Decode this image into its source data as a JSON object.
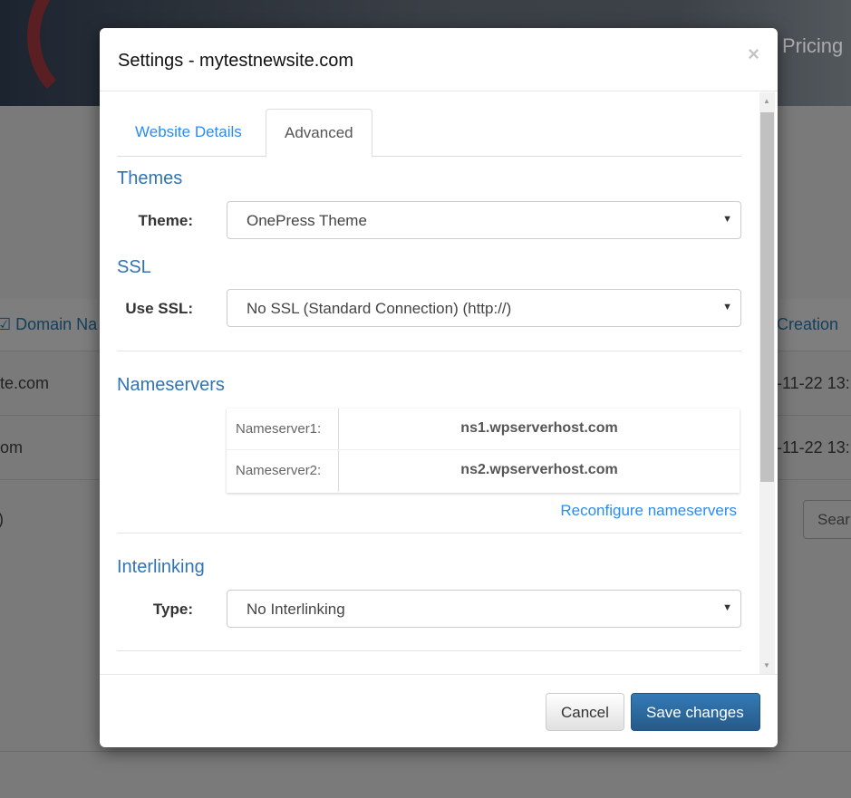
{
  "background": {
    "nav_item": "Pricing",
    "table_header": [
      "☑ Domain Na",
      "Creation"
    ],
    "rows": [
      [
        "te.com",
        "-11-22 13:"
      ],
      [
        "om",
        "-11-22 13:"
      ]
    ],
    "footer_text": ")",
    "search_button": "Sear"
  },
  "modal": {
    "title": "Settings - mytestnewsite.com",
    "close": "×",
    "tabs": [
      {
        "label": "Website Details",
        "active": false
      },
      {
        "label": "Advanced",
        "active": true
      }
    ],
    "themes": {
      "heading": "Themes",
      "label": "Theme:",
      "value": "OnePress Theme"
    },
    "ssl": {
      "heading": "SSL",
      "label": "Use SSL:",
      "value": "No SSL (Standard Connection) (http://)"
    },
    "nameservers": {
      "heading": "Nameservers",
      "rows": [
        {
          "key": "Nameserver1:",
          "value": "ns1.wpserverhost.com"
        },
        {
          "key": "Nameserver2:",
          "value": "ns2.wpserverhost.com"
        }
      ],
      "reconfigure": "Reconfigure nameservers"
    },
    "interlinking": {
      "heading": "Interlinking",
      "label": "Type:",
      "value": "No Interlinking"
    },
    "cancel": "Cancel",
    "save": "Save changes"
  },
  "colors": {
    "link": "#2a8cf0",
    "heading": "#3074b5",
    "primary": "#337ab7"
  }
}
